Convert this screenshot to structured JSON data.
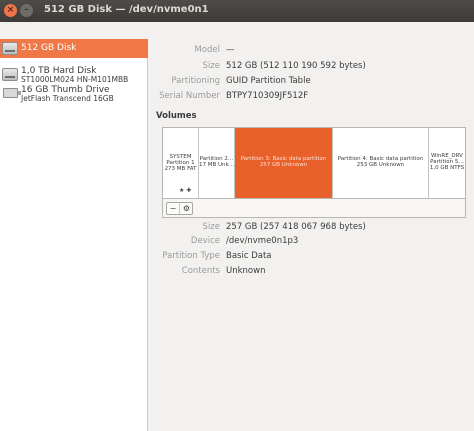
{
  "window": {
    "title": "512 GB Disk — /dev/nvme0n1",
    "close_glyph": "×",
    "minimize_glyph": "–"
  },
  "drives": [
    {
      "name": "512 GB Disk",
      "subtitle": ""
    },
    {
      "name": "1,0 TB Hard Disk",
      "subtitle": "ST1000LM024 HN-M101MBB"
    },
    {
      "name": "16 GB Thumb Drive",
      "subtitle": "JetFlash Transcend 16GB"
    }
  ],
  "disk": {
    "model_label": "Model",
    "model": "—",
    "size_label": "Size",
    "size": "512 GB (512 110 190 592 bytes)",
    "partitioning_label": "Partitioning",
    "partitioning": "GUID Partition Table",
    "serial_label": "Serial Number",
    "serial": "BTPY710309JF512F"
  },
  "volumes": {
    "heading": "Volumes",
    "partitions": [
      {
        "line1": "SYSTEM",
        "line2": "Partition 1",
        "line3": "273 MB FAT",
        "star": "★ ✚"
      },
      {
        "line1": "Partition 2…",
        "line2": "17 MB Unk…"
      },
      {
        "line1": "Partition 3: Basic data partition",
        "line2": "257 GB Unknown"
      },
      {
        "line1": "Partition 4: Basic data partition",
        "line2": "253 GB Unknown"
      },
      {
        "line1": "WinRE_DRV",
        "line2": "Partition 5…",
        "line3": "1,0 GB NTFS"
      }
    ],
    "toolbar": {
      "minus_glyph": "−",
      "gears_glyph": "⚙"
    }
  },
  "partition": {
    "size_label": "Size",
    "size": "257 GB (257 418 067 968 bytes)",
    "device_label": "Device",
    "device": "/dev/nvme0n1p3",
    "type_label": "Partition Type",
    "type": "Basic Data",
    "contents_label": "Contents",
    "contents": "Unknown"
  }
}
